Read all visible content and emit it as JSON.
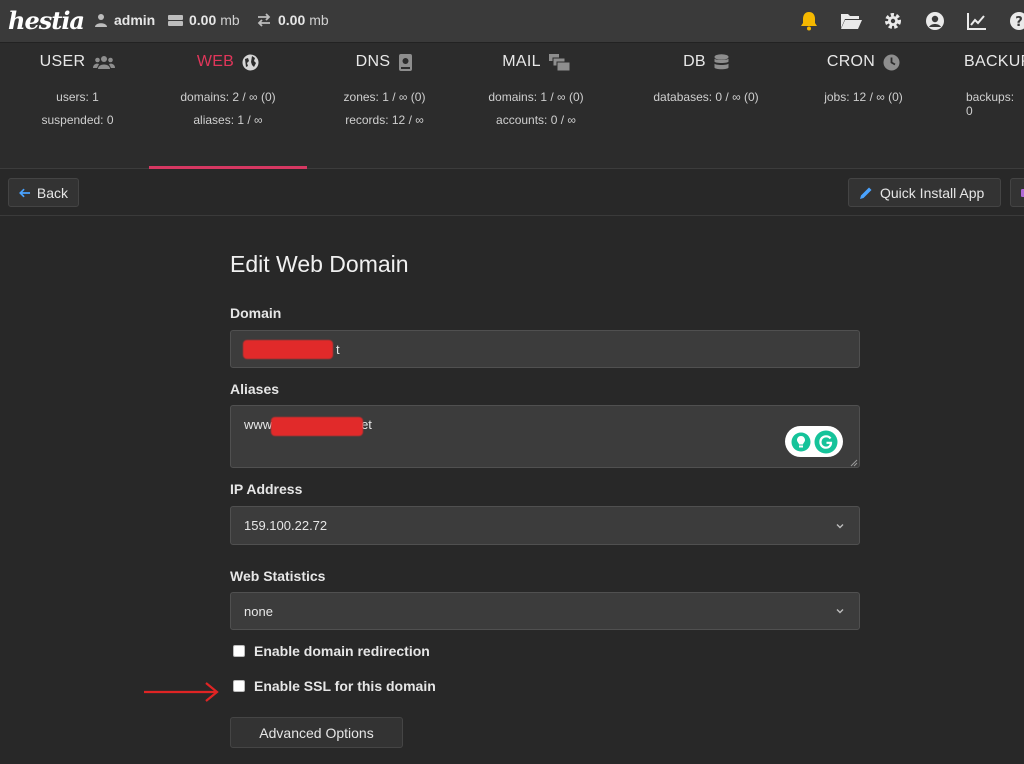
{
  "app": {
    "logo_text": "hestia",
    "user": "admin",
    "disk": {
      "value": "0.00",
      "unit": "mb"
    },
    "bandwidth": {
      "value": "0.00",
      "unit": "mb"
    },
    "top_icons": [
      "bell-icon",
      "folder-icon",
      "gear-icon",
      "user-circle-icon",
      "chart-line-icon",
      "help-icon"
    ],
    "accent_color": "#e0365a"
  },
  "tabs": [
    {
      "name": "USER",
      "icon": "users-icon",
      "line1": "users: 1",
      "line2": "suspended: 0"
    },
    {
      "name": "WEB",
      "icon": "globe-icon",
      "line1": "domains: 2 / ∞ (0)",
      "line2": "aliases: 1 / ∞",
      "active": true
    },
    {
      "name": "DNS",
      "icon": "book-icon",
      "line1": "zones: 1 / ∞ (0)",
      "line2": "records: 12 / ∞"
    },
    {
      "name": "MAIL",
      "icon": "mail-bulk-icon",
      "line1": "domains: 1 / ∞ (0)",
      "line2": "accounts: 0 / ∞"
    },
    {
      "name": "DB",
      "icon": "database-icon",
      "line1": "databases: 0 / ∞ (0)",
      "line2": ""
    },
    {
      "name": "CRON",
      "icon": "clock-icon",
      "line1": "jobs: 12 / ∞ (0)",
      "line2": ""
    },
    {
      "name": "BACKUP",
      "icon": "",
      "line1": "backups: 0",
      "line2": ""
    }
  ],
  "toolbar": {
    "back_label": "Back",
    "quick_install_label": "Quick Install App"
  },
  "form": {
    "title": "Edit Web Domain",
    "domain_label": "Domain",
    "domain_value_suffix": "t",
    "aliases_label": "Aliases",
    "aliases_value_prefix": "www.",
    "aliases_value_suffix": "et",
    "ip_label": "IP Address",
    "ip_value": "159.100.22.72",
    "stats_label": "Web Statistics",
    "stats_value": "none",
    "redirect_label": "Enable domain redirection",
    "ssl_label": "Enable SSL for this domain",
    "advanced_label": "Advanced Options"
  }
}
